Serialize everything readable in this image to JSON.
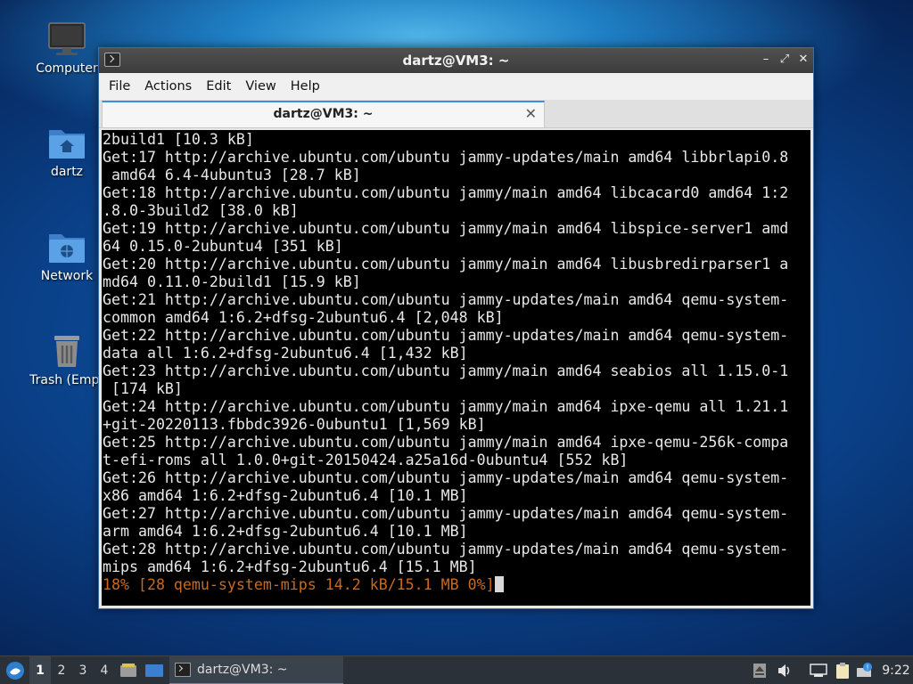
{
  "desktop": {
    "icons": [
      {
        "label": "Computer",
        "icon": "monitor-icon"
      },
      {
        "label": "dartz",
        "icon": "home-folder-icon"
      },
      {
        "label": "Network",
        "icon": "network-folder-icon"
      },
      {
        "label": "Trash (Empt",
        "icon": "trash-icon"
      }
    ]
  },
  "window": {
    "title": "dartz@VM3: ~",
    "menu": [
      "File",
      "Actions",
      "Edit",
      "View",
      "Help"
    ],
    "tab": {
      "label": "dartz@VM3: ~"
    },
    "controls": {
      "minimize": "–",
      "maximize": "⤢",
      "close": "✕"
    }
  },
  "terminal": {
    "lines": [
      "2build1 [10.3 kB]",
      "Get:17 http://archive.ubuntu.com/ubuntu jammy-updates/main amd64 libbrlapi0.8",
      " amd64 6.4-4ubuntu3 [28.7 kB]",
      "Get:18 http://archive.ubuntu.com/ubuntu jammy/main amd64 libcacard0 amd64 1:2",
      ".8.0-3build2 [38.0 kB]",
      "Get:19 http://archive.ubuntu.com/ubuntu jammy/main amd64 libspice-server1 amd",
      "64 0.15.0-2ubuntu4 [351 kB]",
      "Get:20 http://archive.ubuntu.com/ubuntu jammy/main amd64 libusbredirparser1 a",
      "md64 0.11.0-2build1 [15.9 kB]",
      "Get:21 http://archive.ubuntu.com/ubuntu jammy-updates/main amd64 qemu-system-",
      "common amd64 1:6.2+dfsg-2ubuntu6.4 [2,048 kB]",
      "Get:22 http://archive.ubuntu.com/ubuntu jammy-updates/main amd64 qemu-system-",
      "data all 1:6.2+dfsg-2ubuntu6.4 [1,432 kB]",
      "Get:23 http://archive.ubuntu.com/ubuntu jammy/main amd64 seabios all 1.15.0-1",
      " [174 kB]",
      "Get:24 http://archive.ubuntu.com/ubuntu jammy/main amd64 ipxe-qemu all 1.21.1",
      "+git-20220113.fbbdc3926-0ubuntu1 [1,569 kB]",
      "Get:25 http://archive.ubuntu.com/ubuntu jammy/main amd64 ipxe-qemu-256k-compa",
      "t-efi-roms all 1.0.0+git-20150424.a25a16d-0ubuntu4 [552 kB]",
      "Get:26 http://archive.ubuntu.com/ubuntu jammy-updates/main amd64 qemu-system-",
      "x86 amd64 1:6.2+dfsg-2ubuntu6.4 [10.1 MB]",
      "Get:27 http://archive.ubuntu.com/ubuntu jammy-updates/main amd64 qemu-system-",
      "arm amd64 1:6.2+dfsg-2ubuntu6.4 [10.1 MB]",
      "Get:28 http://archive.ubuntu.com/ubuntu jammy-updates/main amd64 qemu-system-",
      "mips amd64 1:6.2+dfsg-2ubuntu6.4 [15.1 MB]"
    ],
    "status_line": "18% [28 qemu-system-mips 14.2 kB/15.1 MB 0%]",
    "status_color": "#c86b1f",
    "background": "#000000"
  },
  "taskbar": {
    "workspaces": [
      "1",
      "2",
      "3",
      "4"
    ],
    "active_workspace": "1",
    "task_label": "dartz@VM3: ~",
    "clock": "9:22",
    "tray_icons": [
      "eject-icon",
      "volume-icon",
      "network-icon",
      "clipboard-icon",
      "notification-icon"
    ]
  },
  "colors": {
    "tab_accent": "#3d8ee0",
    "window_border": "#3a6ea5",
    "taskbar_bg": "#2b3138"
  }
}
